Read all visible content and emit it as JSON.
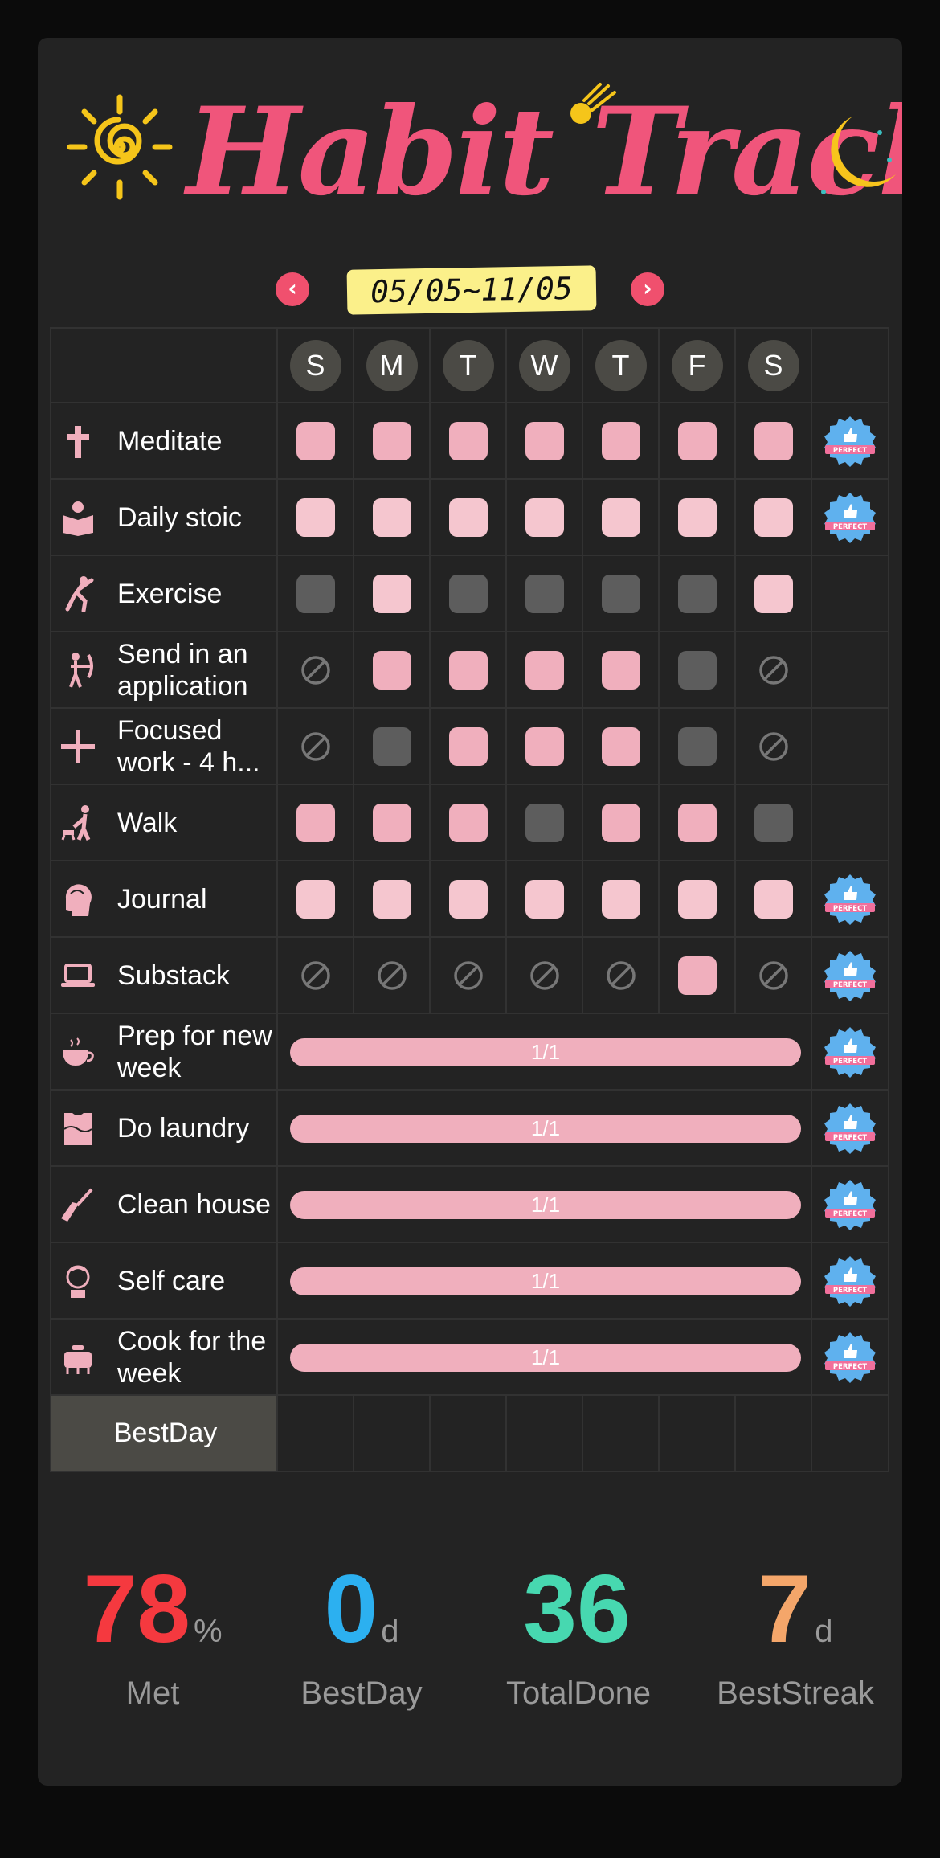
{
  "header": {
    "title": "Habit Tracker"
  },
  "date_nav": {
    "range": "05/05~11/05",
    "prev_icon": "chevron-left-icon",
    "next_icon": "chevron-right-icon"
  },
  "days": [
    "S",
    "M",
    "T",
    "W",
    "T",
    "F",
    "S"
  ],
  "colors": {
    "done": "#f0afbd",
    "done_light": "#f5c6cf",
    "not_done": "#5d5d5d",
    "accent": "#f0557b"
  },
  "habits": [
    {
      "name": "Meditate",
      "icon": "cross-icon",
      "status": [
        "on",
        "on",
        "on",
        "on",
        "on",
        "on",
        "on"
      ],
      "perfect": true
    },
    {
      "name": "Daily stoic",
      "icon": "reading-icon",
      "status": [
        "light",
        "light",
        "light",
        "light",
        "light",
        "light",
        "light"
      ],
      "perfect": true
    },
    {
      "name": "Exercise",
      "icon": "exercise-icon",
      "status": [
        "off",
        "light",
        "off",
        "off",
        "off",
        "off",
        "light"
      ],
      "perfect": false
    },
    {
      "name": "Send in an application",
      "icon": "archer-icon",
      "status": [
        "skip",
        "on",
        "on",
        "on",
        "on",
        "off",
        "skip"
      ],
      "perfect": false
    },
    {
      "name": "Focused work - 4 h...",
      "icon": "plus-icon",
      "status": [
        "skip",
        "off",
        "on",
        "on",
        "on",
        "off",
        "skip"
      ],
      "perfect": false
    },
    {
      "name": "Walk",
      "icon": "dog-walk-icon",
      "status": [
        "on",
        "on",
        "on",
        "off",
        "on",
        "on",
        "off"
      ],
      "perfect": false
    },
    {
      "name": "Journal",
      "icon": "head-icon",
      "status": [
        "light",
        "light",
        "light",
        "light",
        "light",
        "light",
        "light"
      ],
      "perfect": true
    },
    {
      "name": "Substack",
      "icon": "laptop-icon",
      "status": [
        "skip",
        "skip",
        "skip",
        "skip",
        "skip",
        "on",
        "skip"
      ],
      "perfect": true
    },
    {
      "name": "Prep for new week",
      "icon": "cup-icon",
      "progress": "1/1",
      "perfect": true
    },
    {
      "name": "Do laundry",
      "icon": "laundry-icon",
      "progress": "1/1",
      "perfect": true
    },
    {
      "name": "Clean house",
      "icon": "broom-icon",
      "progress": "1/1",
      "perfect": true
    },
    {
      "name": "Self care",
      "icon": "face-mask-icon",
      "progress": "1/1",
      "perfect": true
    },
    {
      "name": "Cook for the week",
      "icon": "pot-icon",
      "progress": "1/1",
      "perfect": true
    }
  ],
  "badge_text": "PERFECT",
  "bestday_label": "BestDay",
  "stats": [
    {
      "value": "78",
      "unit": "%",
      "label": "Met",
      "color": "#f5393f"
    },
    {
      "value": "0",
      "unit": "d",
      "label": "BestDay",
      "color": "#2cb0f0"
    },
    {
      "value": "36",
      "unit": "",
      "label": "TotalDone",
      "color": "#47d8b0"
    },
    {
      "value": "7",
      "unit": "d",
      "label": "BestStreak",
      "color": "#f4a66a"
    }
  ]
}
